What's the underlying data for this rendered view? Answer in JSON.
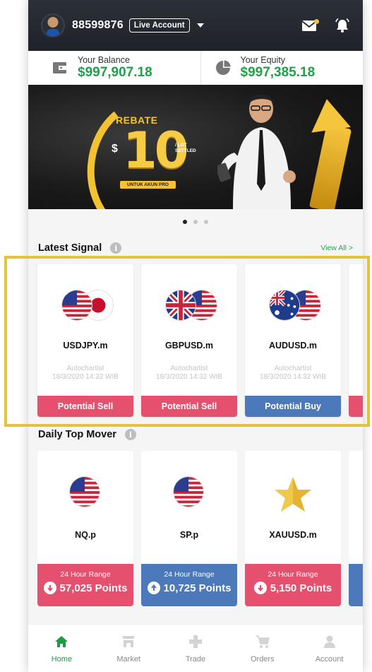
{
  "header": {
    "account_id": "88599876",
    "account_type": "Live Account"
  },
  "balance": {
    "balance_label": "Your Balance",
    "balance_value": "$997,907.18",
    "equity_label": "Your Equity",
    "equity_value": "$997,385.18"
  },
  "banner": {
    "rebate": "REBATE",
    "currency": "$",
    "amount": "10",
    "per_lot": "/ LOT\nSETTLED",
    "note": "UNTUK AKUN PRO",
    "pages": 3,
    "active_page": 1
  },
  "latest_signal": {
    "title": "Latest Signal",
    "info": "i",
    "view_all": "View All >",
    "items": [
      {
        "pair": "USDJPY.m",
        "source": "Autochartist",
        "time": "18/3/2020 14:32 WIB",
        "action": "Potential Sell"
      },
      {
        "pair": "GBPUSD.m",
        "source": "Autochartist",
        "time": "18/3/2020 14:32 WIB",
        "action": "Potential Sell"
      },
      {
        "pair": "AUDUSD.m",
        "source": "Autochartist",
        "time": "18/3/2020 14:32 WIB",
        "action": "Potential Buy"
      }
    ]
  },
  "top_mover": {
    "title": "Daily Top Mover",
    "info": "i",
    "items": [
      {
        "symbol": "NQ.p",
        "range_label": "24 Hour Range",
        "range_value": "57,025 Points",
        "direction": "down"
      },
      {
        "symbol": "SP.p",
        "range_label": "24 Hour Range",
        "range_value": "10,725 Points",
        "direction": "up"
      },
      {
        "symbol": "XAUUSD.m",
        "range_label": "24 Hour Range",
        "range_value": "5,150 Points",
        "direction": "down"
      }
    ]
  },
  "colors": {
    "accent_green": "#21a04a",
    "sell": "#e5506e",
    "buy": "#4b79b9",
    "highlight": "#e2c43b"
  },
  "tabs": [
    {
      "label": "Home",
      "icon": "home-icon",
      "active": true
    },
    {
      "label": "Market",
      "icon": "market-icon",
      "active": false
    },
    {
      "label": "Trade",
      "icon": "plus-icon",
      "active": false
    },
    {
      "label": "Orders",
      "icon": "cart-icon",
      "active": false
    },
    {
      "label": "Account",
      "icon": "user-icon",
      "active": false
    }
  ]
}
